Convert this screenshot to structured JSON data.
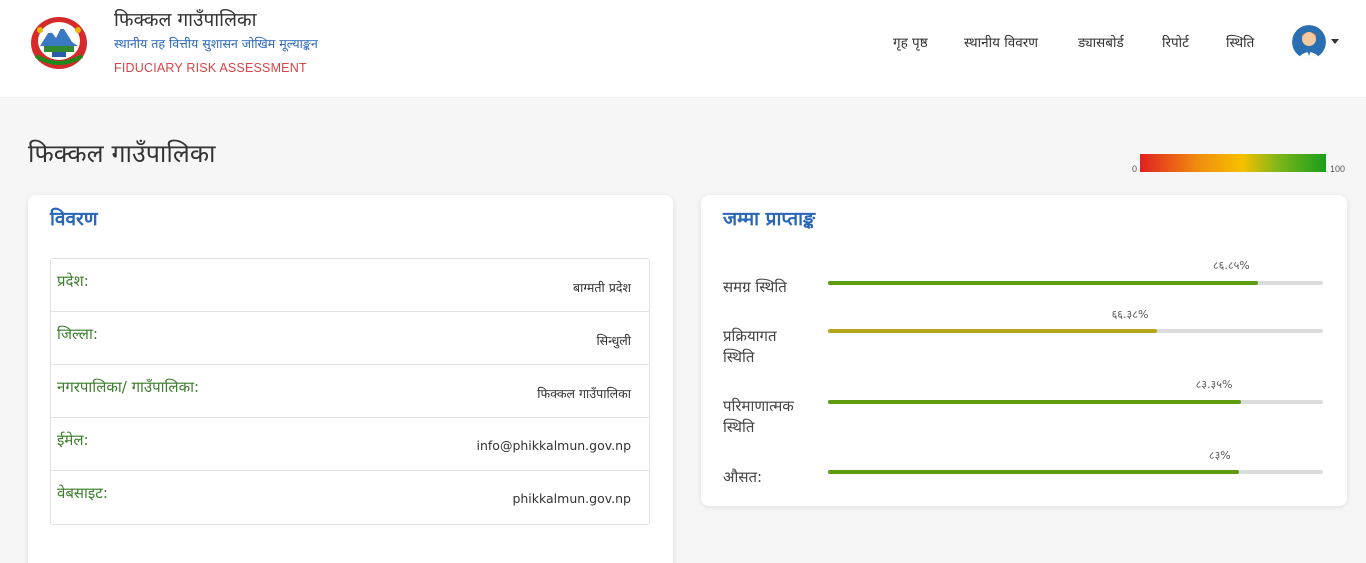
{
  "header": {
    "title": "फिक्कल गाउँपालिका",
    "subtitle": "स्थानीय तह वित्तीय सुशासन जोखिम मूल्याङ्कन",
    "subtitle_en": "FIDUCIARY RISK ASSESSMENT",
    "logo_icon": "nepal-emblem-icon",
    "nav": [
      {
        "label": "गृह पृष्ठ"
      },
      {
        "label": "स्थानीय विवरण"
      },
      {
        "label": "ड्यासबोर्ड"
      },
      {
        "label": "रिपोर्ट"
      },
      {
        "label": "स्थिति"
      }
    ],
    "avatar_icon": "user-avatar-icon"
  },
  "page": {
    "title": "फिक्कल गाउँपालिका",
    "legend": {
      "min": "0",
      "max": "100",
      "colors": [
        "#e02020",
        "#f08a10",
        "#f6c000",
        "#7ab51a",
        "#1a9e1a"
      ]
    }
  },
  "details": {
    "title": "विवरण",
    "rows": [
      {
        "label": "प्रदेश:",
        "value": "बाग्मती प्रदेश"
      },
      {
        "label": "जिल्ला:",
        "value": "सिन्धुली"
      },
      {
        "label": "नगरपालिका/ गाउँपालिका:",
        "value": "फिक्कल गाउँपालिका"
      },
      {
        "label": "ईमेल:",
        "value": "info@phikkalmun.gov.np"
      },
      {
        "label": "वेबसाइट:",
        "value": "phikkalmun.gov.np"
      }
    ]
  },
  "scores": {
    "title": "जम्मा प्राप्ताङ्क",
    "items": [
      {
        "label": "समग्र स्थिति",
        "value": 86.85,
        "display": "८६.८५%",
        "color": "#5e9c0f"
      },
      {
        "label": "प्रक्रियागत स्थिति",
        "value": 66.38,
        "display": "६६.३८%",
        "color": "#b5a51a"
      },
      {
        "label": "परिमाणात्मक स्थिति",
        "value": 83.35,
        "display": "८३.३५%",
        "color": "#5e9c0f"
      },
      {
        "label": "औसत:",
        "value": 83,
        "display": "८३%",
        "color": "#5e9c0f"
      }
    ]
  },
  "colors": {
    "accent_blue": "#2a66b8",
    "label_green": "#3a7d2a",
    "brand_red": "#d64545"
  }
}
